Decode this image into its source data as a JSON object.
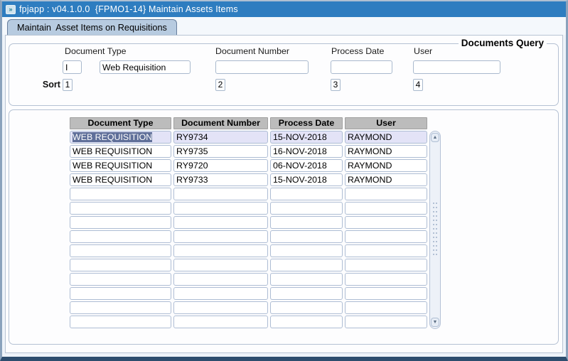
{
  "window": {
    "title": "fpjapp : v04.1.0.0  {FPMO1-14} Maintain Assets Items"
  },
  "tab": {
    "label": "Maintain  Asset Items on Requisitions"
  },
  "query": {
    "group_title": "Documents Query",
    "sort_label": "Sort",
    "document_type": {
      "label": "Document Type",
      "code": "I",
      "value": "Web Requisition",
      "sort": "1"
    },
    "document_number": {
      "label": "Document Number",
      "value": "",
      "sort": "2"
    },
    "process_date": {
      "label": "Process Date",
      "value": "",
      "sort": "3"
    },
    "user": {
      "label": "User",
      "value": "",
      "sort": "4"
    }
  },
  "table": {
    "columns": [
      "Document Type",
      "Document Number",
      "Process Date",
      "User"
    ],
    "rows": [
      [
        "WEB REQUISITION",
        "RY9734",
        "15-NOV-2018",
        "RAYMOND"
      ],
      [
        "WEB REQUISITION",
        "RY9735",
        "16-NOV-2018",
        "RAYMOND"
      ],
      [
        "WEB REQUISITION",
        "RY9720",
        "06-NOV-2018",
        "RAYMOND"
      ],
      [
        "WEB REQUISITION",
        "RY9733",
        "15-NOV-2018",
        "RAYMOND"
      ]
    ],
    "empty_row_count": 10,
    "selected_row_index": 0
  },
  "scrollbar": {
    "up_icon": "▲",
    "down_icon": "▼"
  },
  "icons": {
    "app_icon_glyph": "»"
  },
  "colors": {
    "titlebar_blue": "#2e7dc0",
    "tab_bg": "#b7cbe0",
    "header_gray": "#bcbcbc",
    "selected_row_bg": "#e3e3f7",
    "selection_bg": "#5f6f99",
    "selection_text": "#ffffff",
    "field_border": "#a9b9cd",
    "window_bottom_border": "#2d4d6e"
  }
}
